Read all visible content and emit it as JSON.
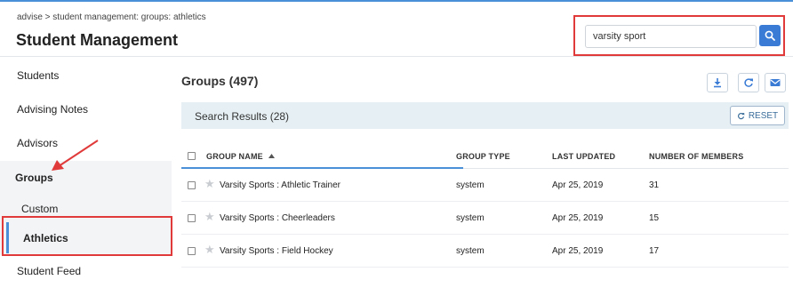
{
  "header": {
    "breadcrumb": "advise > student management: groups: athletics",
    "title": "Student Management"
  },
  "search": {
    "value": "varsity sport"
  },
  "sidebar": {
    "items": [
      {
        "label": "Students"
      },
      {
        "label": "Advising Notes"
      },
      {
        "label": "Advisors"
      },
      {
        "label": "Groups"
      },
      {
        "label": "Custom"
      },
      {
        "label": "Athletics"
      },
      {
        "label": "Student Feed"
      }
    ]
  },
  "main": {
    "title": "Groups (497)",
    "results_label": "Search Results (28)",
    "reset_label": "RESET",
    "columns": [
      "GROUP NAME",
      "GROUP TYPE",
      "LAST UPDATED",
      "NUMBER OF MEMBERS"
    ],
    "rows": [
      {
        "name": "Varsity Sports : Athletic Trainer",
        "type": "system",
        "updated": "Apr 25, 2019",
        "members": "31"
      },
      {
        "name": "Varsity Sports : Cheerleaders",
        "type": "system",
        "updated": "Apr 25, 2019",
        "members": "15"
      },
      {
        "name": "Varsity Sports : Field Hockey",
        "type": "system",
        "updated": "Apr 25, 2019",
        "members": "17"
      }
    ]
  },
  "colors": {
    "accent": "#4a90d9",
    "highlight": "#e03a3a",
    "search_button": "#3a7bd5",
    "results_bar": "#e6f0f4"
  }
}
